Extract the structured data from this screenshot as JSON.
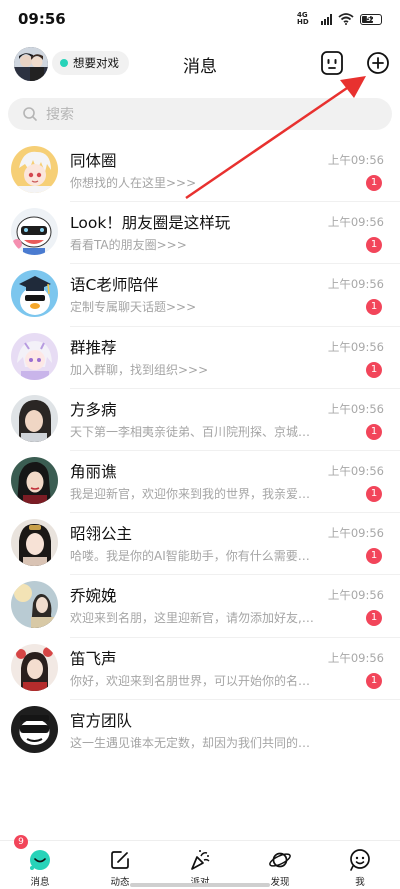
{
  "status_bar": {
    "time": "09:56",
    "network": "4G HD",
    "battery": "52"
  },
  "header": {
    "title": "消息",
    "status_label": "想要对戏",
    "status_color": "#27d3b9",
    "icons": [
      "robot-face-icon",
      "plus-circle-icon"
    ]
  },
  "search": {
    "placeholder": "搜索"
  },
  "chats": [
    {
      "name": "同体圈",
      "preview": "你想找的人在这里>>>",
      "time": "上午09:56",
      "badge": "1"
    },
    {
      "name": "Look！朋友圈是这样玩",
      "preview": "看看TA的朋友圈>>>",
      "time": "上午09:56",
      "badge": "1"
    },
    {
      "name": "语C老师陪伴",
      "preview": "定制专属聊天话题>>>",
      "time": "上午09:56",
      "badge": "1"
    },
    {
      "name": "群推荐",
      "preview": "加入群聊，找到组织>>>",
      "time": "上午09:56",
      "badge": "1"
    },
    {
      "name": "方多病",
      "preview": "天下第一李相夷亲徒弟、百川院刑探、京城…",
      "time": "上午09:56",
      "badge": "1"
    },
    {
      "name": "角丽谯",
      "preview": "我是迎新官，欢迎你来到我的世界，我亲爱…",
      "time": "上午09:56",
      "badge": "1"
    },
    {
      "name": "昭翎公主",
      "preview": "哈喽。我是你的AI智能助手，你有什么需要…",
      "time": "上午09:56",
      "badge": "1"
    },
    {
      "name": "乔婉娩",
      "preview": "欢迎来到名朋，这里迎新官，请勿添加好友,…",
      "time": "上午09:56",
      "badge": "1"
    },
    {
      "name": "笛飞声",
      "preview": "你好，欢迎来到名朋世界，可以开始你的名…",
      "time": "上午09:56",
      "badge": "1"
    },
    {
      "name": "官方团队",
      "preview": "这一生遇见谁本无定数，却因为我们共同的…",
      "time": "",
      "badge": ""
    }
  ],
  "bottom_nav": [
    {
      "label": "消息",
      "icon": "chat-bubble-icon",
      "badge": "9"
    },
    {
      "label": "动态",
      "icon": "edit-icon",
      "badge": ""
    },
    {
      "label": "派对",
      "icon": "party-popper-icon",
      "badge": ""
    },
    {
      "label": "发现",
      "icon": "planet-icon",
      "badge": ""
    },
    {
      "label": "我",
      "icon": "smile-face-icon",
      "badge": ""
    }
  ],
  "colors": {
    "accent": "#27d3b9",
    "badge": "#f2455a",
    "annotation_arrow": "#e8312f"
  }
}
